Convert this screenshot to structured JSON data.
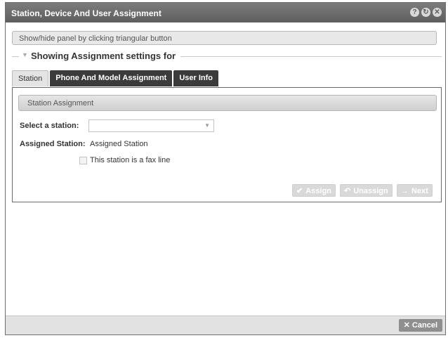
{
  "dialog": {
    "title": "Station, Device And User Assignment",
    "icons": [
      {
        "name": "help-icon",
        "glyph": "?"
      },
      {
        "name": "refresh-icon",
        "glyph": "↻"
      },
      {
        "name": "close-icon",
        "glyph": "✕"
      }
    ]
  },
  "hint": "Show/hide panel by clicking triangular button",
  "section": {
    "legend": "Showing Assignment settings for"
  },
  "tabs": [
    "Station",
    "Phone And Model Assignment",
    "User Info"
  ],
  "station_panel": {
    "header": "Station Assignment",
    "select_label": "Select a station:",
    "select_value": "",
    "assigned_label": "Assigned Station:",
    "assigned_value": "Assigned Station",
    "fax_checkbox_label": "This station is a fax line",
    "fax_checked": false
  },
  "buttons": {
    "assign": "Assign",
    "unassign": "Unassign",
    "next": "Next"
  },
  "footer": {
    "cancel": "Cancel"
  }
}
